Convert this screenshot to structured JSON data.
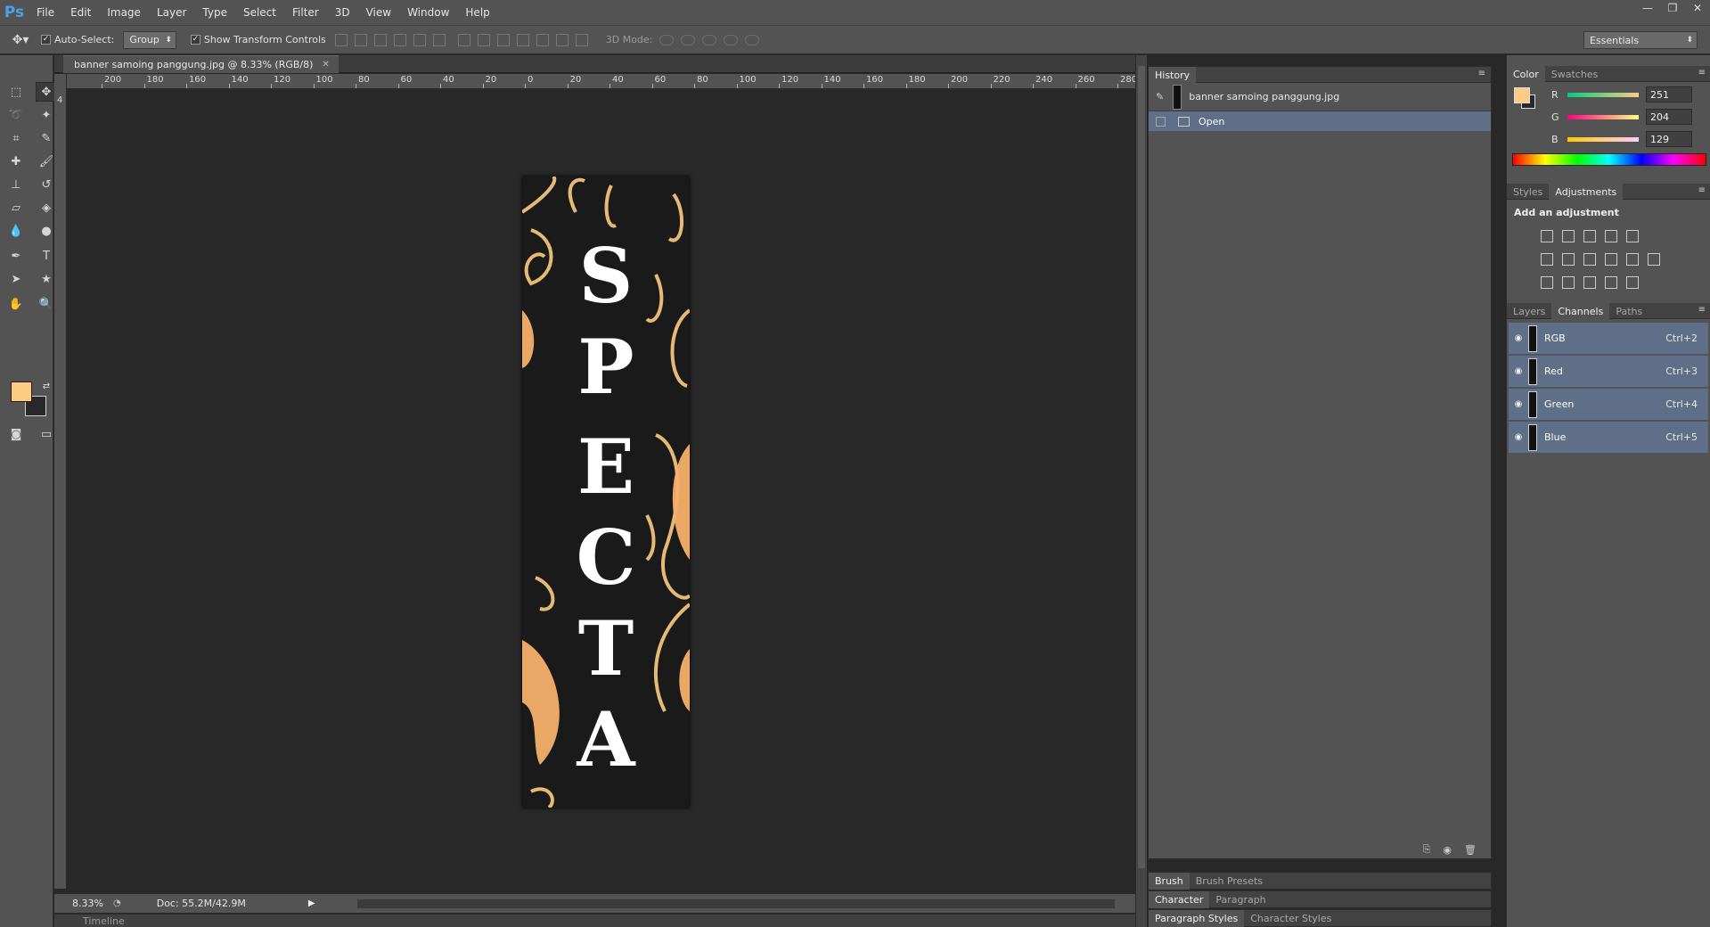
{
  "app": {
    "logo": "Ps"
  },
  "menu": [
    "File",
    "Edit",
    "Image",
    "Layer",
    "Type",
    "Select",
    "Filter",
    "3D",
    "View",
    "Window",
    "Help"
  ],
  "window_controls": [
    "—",
    "❐",
    "✕"
  ],
  "options": {
    "auto_select_label": "Auto-Select:",
    "auto_select_value": "Group",
    "transform_label": "Show Transform Controls",
    "mode3d_label": "3D Mode:",
    "workspace": "Essentials"
  },
  "document": {
    "tab_title": "banner samoing panggung.jpg @ 8.33% (RGB/8)",
    "ruler_labels": [
      "200",
      "180",
      "160",
      "140",
      "120",
      "100",
      "80",
      "60",
      "40",
      "20",
      "0",
      "20",
      "40",
      "60",
      "80",
      "100",
      "120",
      "140",
      "160",
      "180",
      "200",
      "220",
      "240",
      "260",
      "280"
    ],
    "vruler_label": "4",
    "image_letters": [
      "S",
      "P",
      "E",
      "C",
      "T",
      "A"
    ],
    "zoom": "8.33%",
    "doc_info": "Doc: 55.2M/42.9M",
    "timeline": "Timeline"
  },
  "history": {
    "tab": "History",
    "snapshot": "banner samoing panggung.jpg",
    "steps": [
      "Open"
    ]
  },
  "collapsed_panels": {
    "brush": [
      "Brush",
      "Brush Presets"
    ],
    "character": [
      "Character",
      "Paragraph"
    ],
    "styles": [
      "Paragraph Styles",
      "Character Styles"
    ]
  },
  "color_panel": {
    "tabs": [
      "Color",
      "Swatches"
    ],
    "r": "251",
    "g": "204",
    "b": "129",
    "r_label": "R",
    "g_label": "G",
    "b_label": "B",
    "foreground": "#fbcc81"
  },
  "adjustments_panel": {
    "tabs": [
      "Styles",
      "Adjustments"
    ],
    "title": "Add an adjustment"
  },
  "channels_panel": {
    "tabs": [
      "Layers",
      "Channels",
      "Paths"
    ],
    "channels": [
      {
        "name": "RGB",
        "shortcut": "Ctrl+2"
      },
      {
        "name": "Red",
        "shortcut": "Ctrl+3"
      },
      {
        "name": "Green",
        "shortcut": "Ctrl+4"
      },
      {
        "name": "Blue",
        "shortcut": "Ctrl+5"
      }
    ]
  },
  "colors": {
    "accent": "#fbcc81",
    "selection": "#5f6f88",
    "panel": "#535353",
    "canvas": "#282828"
  }
}
